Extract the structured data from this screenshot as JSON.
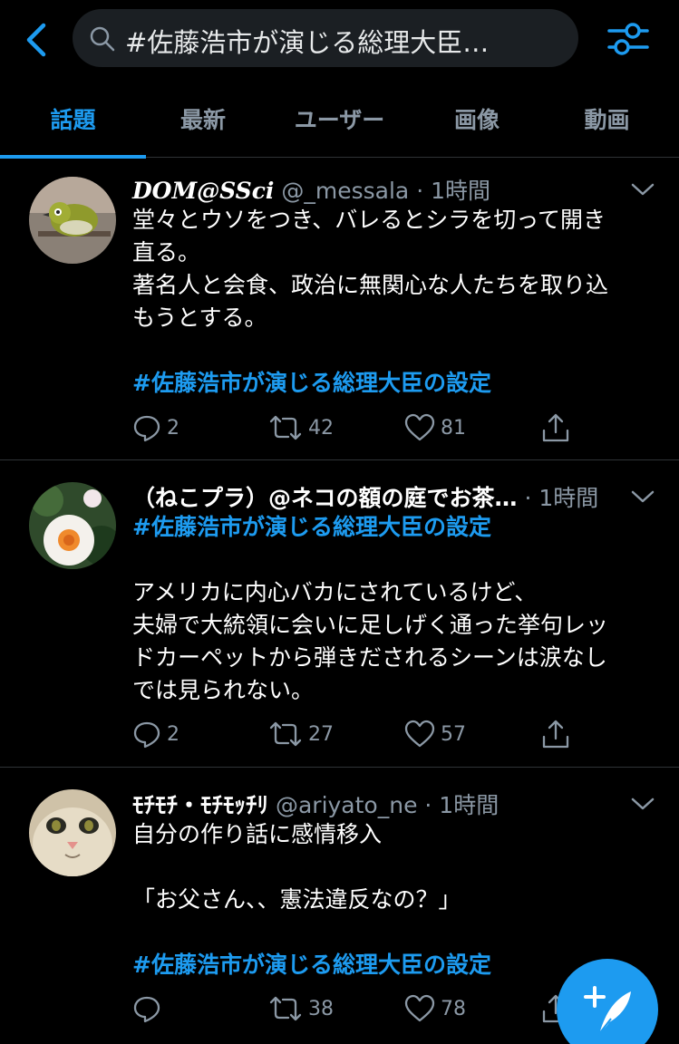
{
  "search": {
    "query": "#佐藤浩市が演じる総理大臣…"
  },
  "tabs": [
    {
      "label": "話題"
    },
    {
      "label": "最新"
    },
    {
      "label": "ユーザー"
    },
    {
      "label": "画像"
    },
    {
      "label": "動画"
    }
  ],
  "tweets": [
    {
      "name": "DOM@SSci",
      "handle": "@_messala",
      "time": "· 1時間",
      "lines": [
        "堂々とウソをつき、バレるとシラを切って開き",
        "直る。",
        "著名人と会食、政治に無関心な人たちを取り込",
        "もうとする。"
      ],
      "hashtag": "#佐藤浩市が演じる総理大臣の設定",
      "replies": "2",
      "retweets": "42",
      "likes": "81"
    },
    {
      "name": "（ねこプラ）@ネコの額の庭でお茶…",
      "handle": "",
      "time": "· 1時間",
      "hashtag": "#佐藤浩市が演じる総理大臣の設定",
      "lines": [
        "アメリカに内心バカにされているけど、",
        "夫婦で大統領に会いに足しげく通った挙句レッ",
        "ドカーペットから弾きだされるシーンは涙なし",
        "では見られない。"
      ],
      "replies": "2",
      "retweets": "27",
      "likes": "57"
    },
    {
      "name": "ﾓﾁﾓﾁ・ﾓﾁﾓｯﾁﾘ",
      "handle": "@ariyato_ne",
      "time": "· 1時間",
      "lines": [
        "自分の作り話に感情移入",
        "",
        "「お父さん、、憲法違反なの？」"
      ],
      "hashtag": "#佐藤浩市が演じる総理大臣の設定",
      "replies": "",
      "retweets": "38",
      "likes": "78"
    }
  ]
}
